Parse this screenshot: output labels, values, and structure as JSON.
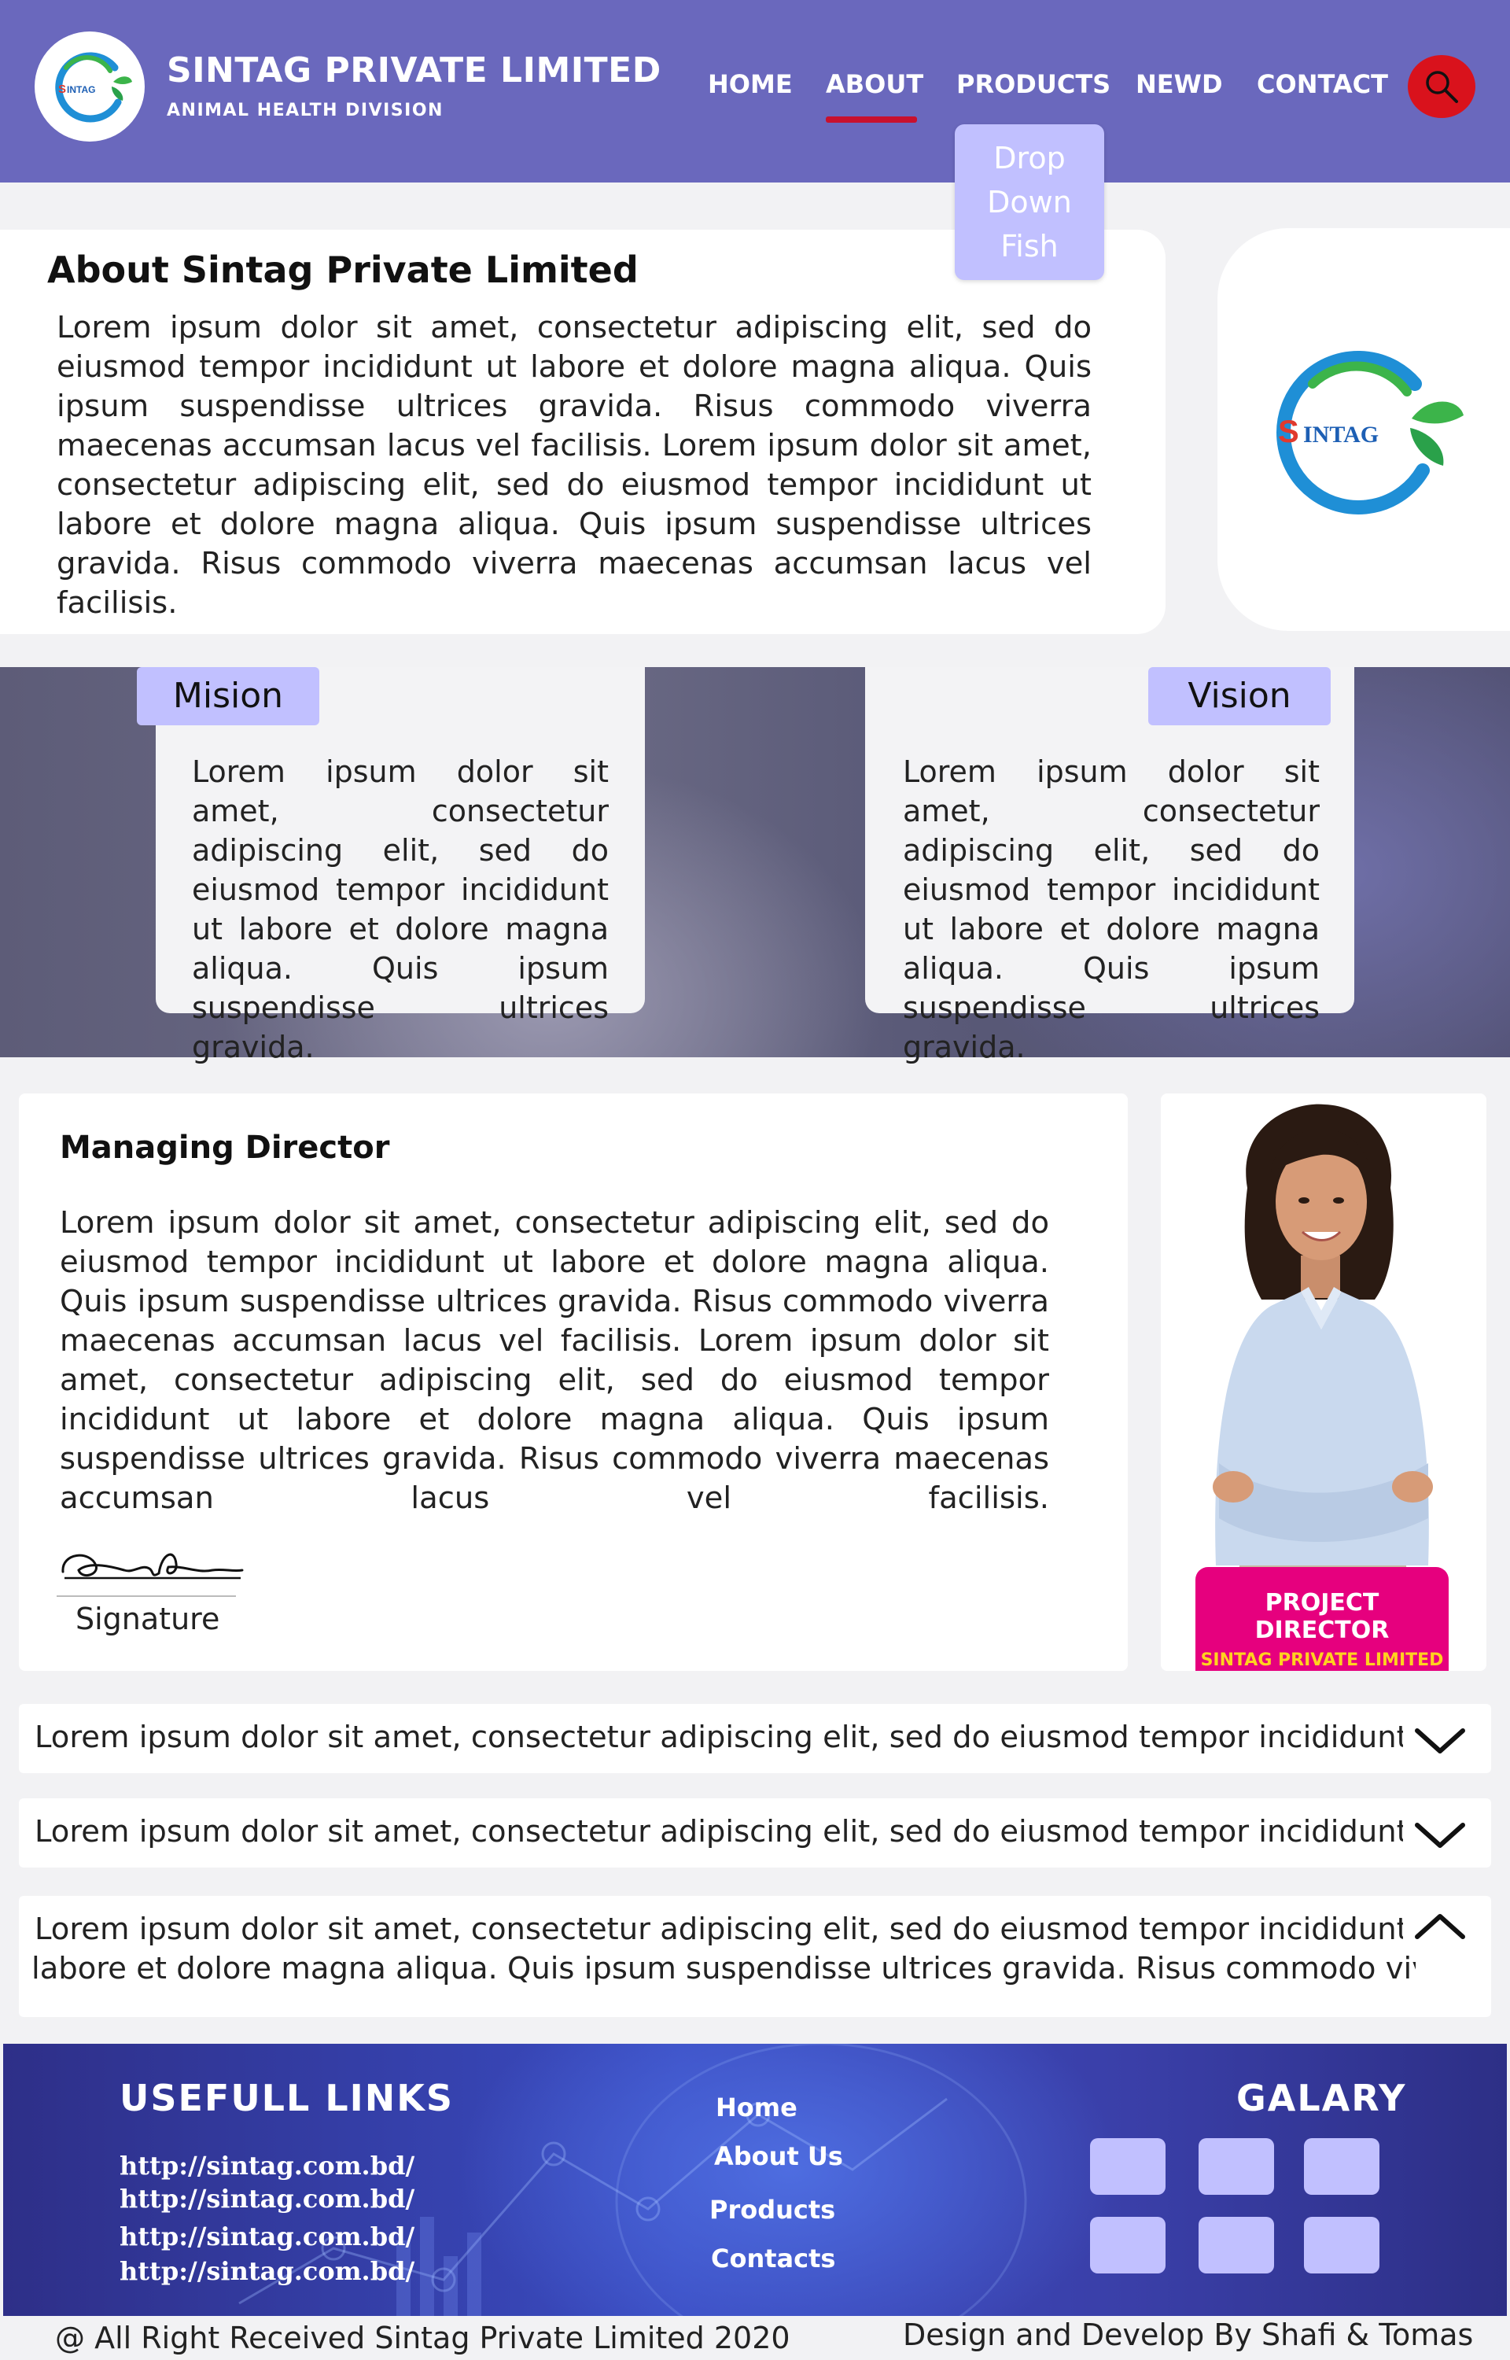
{
  "brand": {
    "name": "SINTAG PRIVATE LIMITED",
    "division": "ANIMAL HEALTH DIVISION",
    "logo_text": "SINTAG",
    "primary_color": "#6a68bd",
    "accent_color": "#c1c0ff"
  },
  "nav": {
    "items": [
      "HOME",
      "ABOUT",
      "PRODUCTS",
      "NEWD",
      "CONTACT"
    ],
    "active": "ABOUT",
    "search_icon": "search-icon",
    "dropdown": [
      "Drop",
      "Down",
      "Fish"
    ]
  },
  "about": {
    "title": "About Sintag Private Limited",
    "text": "Lorem ipsum dolor sit amet, consectetur adipiscing elit, sed do eiusmod tempor incididunt ut labore et dolore magna aliqua. Quis ipsum suspendisse ultrices gravida. Risus commodo viverra maecenas accumsan lacus vel facilisis. Lorem ipsum dolor sit amet, consectetur adipiscing elit, sed do eiusmod tempor incididunt ut labore et dolore magna aliqua. Quis ipsum suspendisse ultrices gravida. Risus commodo viverra maecenas accumsan lacus vel facilisis."
  },
  "mission": {
    "label": "Mision",
    "text": "Lorem ipsum dolor sit amet, consectetur adipiscing elit, sed do eiusmod tempor incididunt ut labore et dolore magna aliqua. Quis ipsum suspendisse ultrices gravida."
  },
  "vision": {
    "label": "Vision",
    "text": "Lorem ipsum dolor sit amet, consectetur adipiscing elit, sed do eiusmod tempor incididunt ut labore et dolore magna aliqua. Quis ipsum suspendisse ultrices gravida."
  },
  "director": {
    "title": "Managing Director",
    "text": "Lorem ipsum dolor sit amet, consectetur adipiscing elit, sed do eiusmod tempor incididunt ut labore et dolore magna aliqua. Quis ipsum suspendisse ultrices gravida. Risus commodo viverra maecenas accumsan lacus vel facilisis. Lorem ipsum dolor sit amet, consectetur adipiscing elit, sed do eiusmod tempor incididunt ut labore et dolore magna aliqua. Quis ipsum suspendisse ultrices gravida. Risus commodo viverra maecenas accumsan lacus vel facilisis.",
    "signature_label": "Signature",
    "badge_title": "PROJECT DIRECTOR",
    "badge_company": "SINTAG PRIVATE LIMITED"
  },
  "accordion": [
    {
      "text": "Lorem ipsum dolor sit amet, consectetur adipiscing elit, sed do eiusmod tempor incididunt ut",
      "expanded": false
    },
    {
      "text": "Lorem ipsum dolor sit amet, consectetur adipiscing elit, sed do eiusmod tempor incididunt ut",
      "expanded": false
    },
    {
      "text": "Lorem ipsum dolor sit amet, consectetur adipiscing elit, sed do eiusmod tempor incididunt ut",
      "text2": "labore et dolore magna aliqua. Quis ipsum suspendisse ultrices gravida. Risus commodo viver-",
      "expanded": true
    }
  ],
  "footer": {
    "links_title": "USEFULL LINKS",
    "links": [
      "http://sintag.com.bd/",
      "http://sintag.com.bd/",
      "http://sintag.com.bd/",
      "http://sintag.com.bd/"
    ],
    "nav": [
      "Home",
      "About Us",
      "Products",
      "Contacts"
    ],
    "gallery_title": "GALARY",
    "copyright": "@ All Right Received Sintag Private Limited 2020",
    "credit": "Design and Develop By Shafi & Tomas"
  }
}
